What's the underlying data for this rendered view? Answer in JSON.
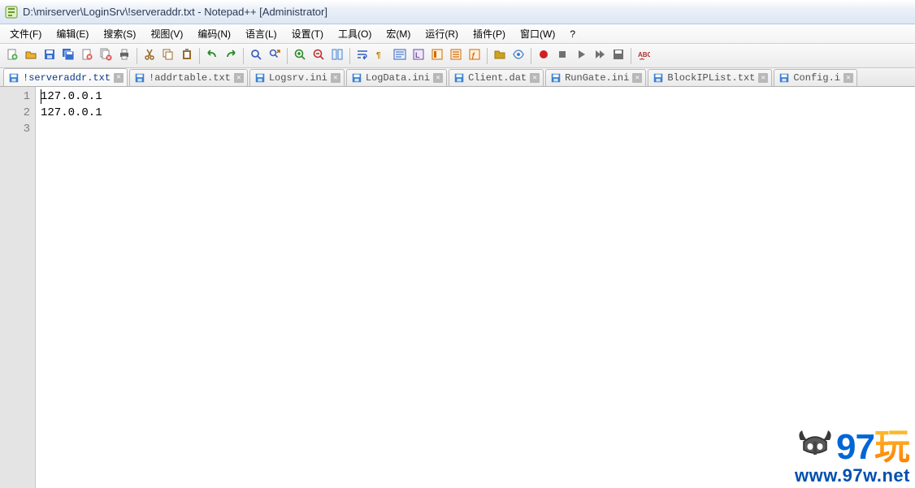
{
  "window": {
    "title": "D:\\mirserver\\LoginSrv\\!serveraddr.txt - Notepad++ [Administrator]"
  },
  "menu": {
    "items": [
      "文件(F)",
      "编辑(E)",
      "搜索(S)",
      "视图(V)",
      "编码(N)",
      "语言(L)",
      "设置(T)",
      "工具(O)",
      "宏(M)",
      "运行(R)",
      "插件(P)",
      "窗口(W)",
      "?"
    ]
  },
  "toolbar": {
    "groups": [
      [
        "new",
        "open",
        "save",
        "save-all",
        "close",
        "close-all",
        "print"
      ],
      [
        "cut",
        "copy",
        "paste"
      ],
      [
        "undo",
        "redo"
      ],
      [
        "find",
        "replace"
      ],
      [
        "zoom-in",
        "zoom-out",
        "sync"
      ],
      [
        "word-wrap",
        "show-all",
        "indent-guide",
        "user-lang",
        "doc-map",
        "doc-list",
        "func-list"
      ],
      [
        "folder",
        "monitor"
      ],
      [
        "record",
        "stop",
        "play",
        "play-multi",
        "save-macro"
      ],
      [
        "spell-check"
      ]
    ],
    "icon_colors": {
      "new": "#4caf50",
      "open": "#f0b030",
      "save": "#3a6ed0",
      "save-all": "#3a6ed0",
      "close": "#e05050",
      "close-all": "#e05050",
      "print": "#606060",
      "cut": "#9a6a2a",
      "copy": "#9a6a2a",
      "paste": "#9a6a2a",
      "undo": "#2a8a2a",
      "redo": "#2a8a2a",
      "find": "#4060c0",
      "replace": "#4060c0",
      "zoom-in": "#2a8a2a",
      "zoom-out": "#c03030",
      "sync": "#4080d0",
      "word-wrap": "#3060c0",
      "show-all": "#c08000",
      "indent-guide": "#3060c0",
      "user-lang": "#6a4aa0",
      "doc-map": "#d06a00",
      "doc-list": "#d06a00",
      "func-list": "#d06a00",
      "folder": "#d0a020",
      "monitor": "#4080d0",
      "record": "#d02020",
      "stop": "#707070",
      "play": "#707070",
      "play-multi": "#707070",
      "save-macro": "#707070",
      "spell-check": "#b03030"
    }
  },
  "tabs": [
    {
      "label": "!serveraddr.txt",
      "active": true
    },
    {
      "label": "!addrtable.txt",
      "active": false
    },
    {
      "label": "Logsrv.ini",
      "active": false
    },
    {
      "label": "LogData.ini",
      "active": false
    },
    {
      "label": "Client.dat",
      "active": false
    },
    {
      "label": "RunGate.ini",
      "active": false
    },
    {
      "label": "BlockIPList.txt",
      "active": false
    },
    {
      "label": "Config.i",
      "active": false
    }
  ],
  "editor": {
    "lines": [
      "127.0.0.1",
      "127.0.0.1",
      ""
    ],
    "line_numbers": [
      "1",
      "2",
      "3"
    ]
  },
  "watermark": {
    "logo_part1": "97",
    "logo_part2": "玩",
    "url": "www.97w.net"
  }
}
